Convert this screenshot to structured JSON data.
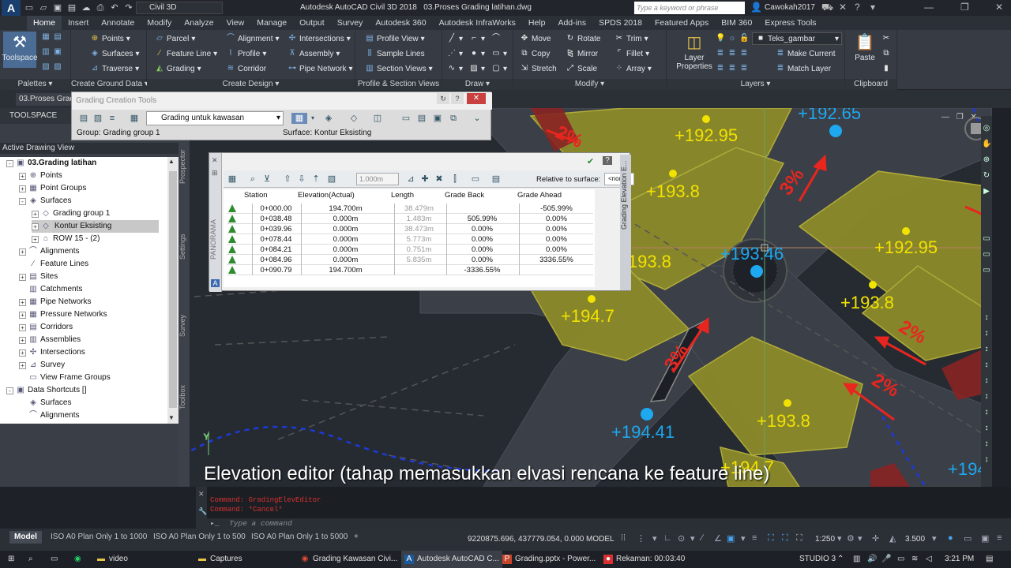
{
  "window": {
    "app_title": "Autodesk AutoCAD Civil 3D 2018",
    "file_title": "03.Proses Grading latihan.dwg",
    "workspace": "Civil 3D",
    "search_placeholder": "Type a keyword or phrase",
    "user": "Cawokah2017",
    "logo_text": "A",
    "logo_sub": "C3D"
  },
  "ribbon_tabs": [
    "Home",
    "Insert",
    "Annotate",
    "Modify",
    "Analyze",
    "View",
    "Manage",
    "Output",
    "Survey",
    "Autodesk 360",
    "Autodesk InfraWorks",
    "Help",
    "Add-ins",
    "SPDS 2018",
    "Featured Apps",
    "BIM 360",
    "Express Tools"
  ],
  "ribbon": {
    "toolspace": "Toolspace",
    "palettes": "Palettes",
    "create_ground": {
      "title": "Create Ground Data",
      "items": [
        "Points",
        "Surfaces",
        "Traverse"
      ]
    },
    "create_design": {
      "title": "Create Design",
      "items": [
        "Parcel",
        "Feature Line",
        "Grading",
        "Alignment",
        "Profile",
        "Corridor",
        "Intersections",
        "Assembly",
        "Pipe Network"
      ]
    },
    "profile_section": {
      "title": "Profile & Section Views",
      "items": [
        "Profile View",
        "Sample Lines",
        "Section Views"
      ]
    },
    "draw": {
      "title": "Draw"
    },
    "modify": {
      "title": "Modify",
      "items": [
        "Move",
        "Copy",
        "Stretch",
        "Rotate",
        "Mirror",
        "Scale",
        "Trim",
        "Fillet",
        "Array"
      ]
    },
    "layers": {
      "title": "Layers",
      "layer_props": "Layer Properties",
      "current_layer": "Teks_gambar",
      "make_current": "Make Current",
      "match_layer": "Match Layer"
    },
    "clipboard": {
      "title": "Clipboard",
      "paste": "Paste"
    }
  },
  "doc_tab": "03.Proses Grad",
  "toolspace": {
    "header": "TOOLSPACE",
    "view": "Active Drawing View",
    "side_tabs": [
      "Prospector",
      "Settings",
      "Survey",
      "Toolbox"
    ],
    "tree": [
      {
        "label": "03.Grading latihan",
        "level": 0,
        "exp": "-",
        "icon": "▣",
        "bold": true
      },
      {
        "label": "Points",
        "level": 1,
        "exp": "+",
        "icon": "⊕"
      },
      {
        "label": "Point Groups",
        "level": 1,
        "exp": "+",
        "icon": "▦"
      },
      {
        "label": "Surfaces",
        "level": 1,
        "exp": "-",
        "icon": "◈"
      },
      {
        "label": "Grading group 1",
        "level": 2,
        "exp": "+",
        "icon": "◇"
      },
      {
        "label": "Kontur Eksisting",
        "level": 2,
        "exp": "+",
        "icon": "◇",
        "selected": true
      },
      {
        "label": "ROW 15 - (2)",
        "level": 2,
        "exp": "+",
        "icon": "⌂"
      },
      {
        "label": "Alignments",
        "level": 1,
        "exp": "+",
        "icon": "⌒"
      },
      {
        "label": "Feature Lines",
        "level": 1,
        "exp": "",
        "icon": "∕"
      },
      {
        "label": "Sites",
        "level": 1,
        "exp": "+",
        "icon": "▤"
      },
      {
        "label": "Catchments",
        "level": 1,
        "exp": "",
        "icon": "▥"
      },
      {
        "label": "Pipe Networks",
        "level": 1,
        "exp": "+",
        "icon": "▦"
      },
      {
        "label": "Pressure Networks",
        "level": 1,
        "exp": "+",
        "icon": "▦"
      },
      {
        "label": "Corridors",
        "level": 1,
        "exp": "+",
        "icon": "▤"
      },
      {
        "label": "Assemblies",
        "level": 1,
        "exp": "+",
        "icon": "▥"
      },
      {
        "label": "Intersections",
        "level": 1,
        "exp": "+",
        "icon": "✣"
      },
      {
        "label": "Survey",
        "level": 1,
        "exp": "+",
        "icon": "⊿"
      },
      {
        "label": "View Frame Groups",
        "level": 1,
        "exp": "",
        "icon": "▭"
      },
      {
        "label": "Data Shortcuts []",
        "level": 0,
        "exp": "-",
        "icon": "▣"
      },
      {
        "label": "Surfaces",
        "level": 1,
        "exp": "",
        "icon": "◈"
      },
      {
        "label": "Alignments",
        "level": 1,
        "exp": "",
        "icon": "⌒"
      }
    ]
  },
  "grading_tools": {
    "title": "Grading Creation Tools",
    "criteria": "Grading untuk kawasan",
    "group": "Group: Grading group 1",
    "surface": "Surface: Kontur Eksisting"
  },
  "elevation_editor": {
    "side_label": "Grading Elevation E...",
    "panorama": "PANORAMA",
    "grade_value": "1.000m",
    "relative_label": "Relative to surface:",
    "relative_value": "<none>",
    "columns": [
      "Station",
      "Elevation(Actual)",
      "Length",
      "Grade Back",
      "Grade Ahead"
    ],
    "rows": [
      [
        "0+000.00",
        "194.700m",
        "38.479m",
        "",
        "-505.99%"
      ],
      [
        "0+038.48",
        "0.000m",
        "1.483m",
        "505.99%",
        "0.00%"
      ],
      [
        "0+039.96",
        "0.000m",
        "38.473m",
        "0.00%",
        "0.00%"
      ],
      [
        "0+078.44",
        "0.000m",
        "5.773m",
        "0.00%",
        "0.00%"
      ],
      [
        "0+084.21",
        "0.000m",
        "0.751m",
        "0.00%",
        "0.00%"
      ],
      [
        "0+084.96",
        "0.000m",
        "5.835m",
        "0.00%",
        "3336.55%"
      ],
      [
        "0+090.79",
        "194.700m",
        "",
        "-3336.55%",
        ""
      ]
    ]
  },
  "drawing_labels": {
    "yellow": [
      "+192.95",
      "+193.8",
      "+193.8",
      "+192.95",
      "+193.8",
      "+194.7",
      "+193.8",
      "+194.7"
    ],
    "blue": [
      "+192.65",
      "+193.46",
      "+194.41",
      "+194"
    ],
    "red": [
      "2%",
      "3%",
      "3%",
      "2%",
      "2%"
    ]
  },
  "subtitle": "Elevation editor (tahap memasukkan elvasi rencana ke feature line)",
  "command": {
    "line1": "Command: GradingElevEditor",
    "line2": "Command: *Cancel*",
    "placeholder": "Type a command"
  },
  "layout_tabs": [
    "Model",
    "ISO A0 Plan Only 1 to 1000",
    "ISO A0 Plan Only 1 to 500",
    "ISO A0 Plan Only 1 to 5000"
  ],
  "status": {
    "coords": "9220875.696, 437779.054, 0.000",
    "space": "MODEL",
    "scale": "1:250",
    "zoom": "3.500"
  },
  "taskbar": {
    "items": [
      "video",
      "Captures",
      "Grading Kawasan Civi...",
      "Autodesk AutoCAD C...",
      "Grading.pptx - Power...",
      "Rekaman: 00:03:40"
    ],
    "studio": "STUDIO 3",
    "time": "3:21 PM"
  }
}
